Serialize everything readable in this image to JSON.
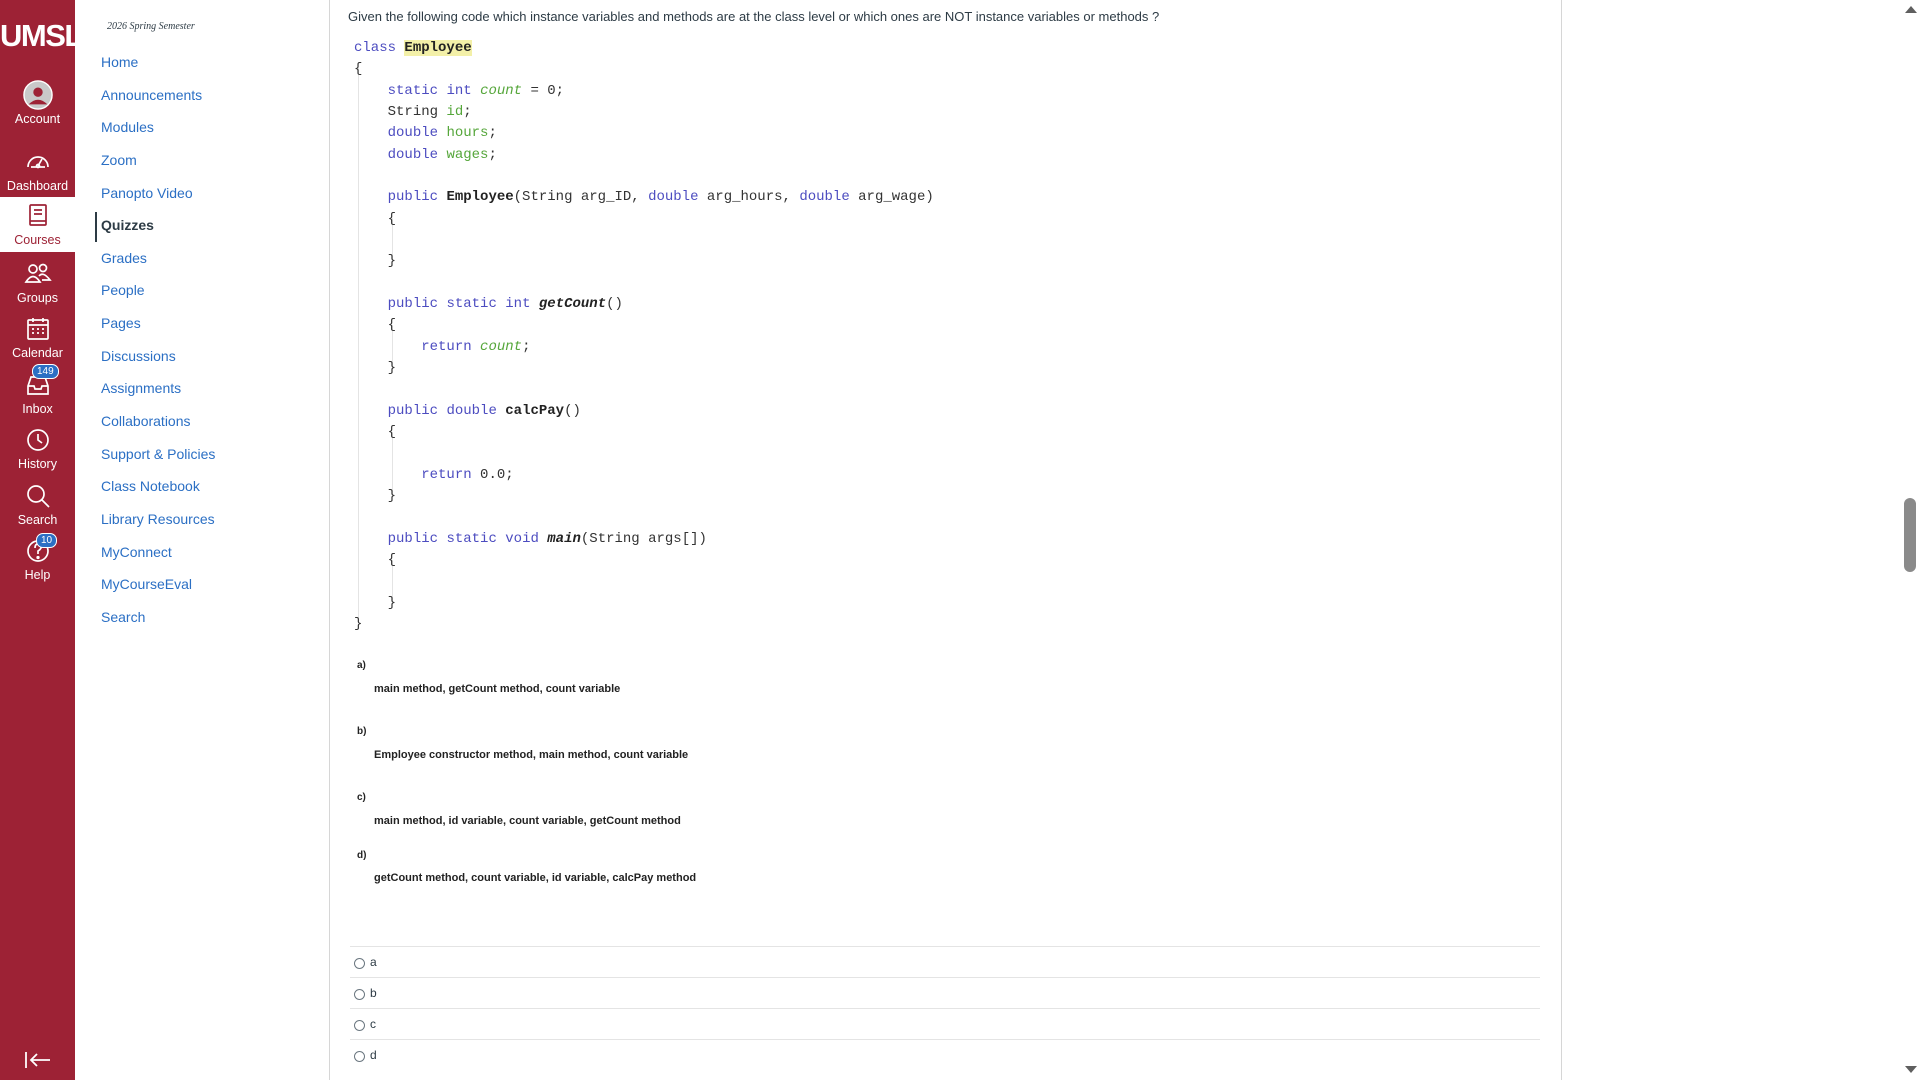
{
  "global_nav": {
    "logo": "UMSL",
    "items": [
      {
        "label": "Account",
        "icon": "account-icon"
      },
      {
        "label": "Dashboard",
        "icon": "dashboard-icon"
      },
      {
        "label": "Courses",
        "icon": "courses-icon",
        "active": true
      },
      {
        "label": "Groups",
        "icon": "groups-icon"
      },
      {
        "label": "Calendar",
        "icon": "calendar-icon"
      },
      {
        "label": "Inbox",
        "icon": "inbox-icon",
        "badge": "149"
      },
      {
        "label": "History",
        "icon": "history-icon"
      },
      {
        "label": "Search",
        "icon": "search-icon"
      },
      {
        "label": "Help",
        "icon": "help-icon",
        "badge": "10"
      }
    ],
    "collapse_icon": "collapse-nav-icon",
    "brand_color": "#9d2235"
  },
  "course_nav": {
    "term": "2026 Spring Semester",
    "items": [
      {
        "label": "Home"
      },
      {
        "label": "Announcements"
      },
      {
        "label": "Modules"
      },
      {
        "label": "Zoom"
      },
      {
        "label": "Panopto Video"
      },
      {
        "label": "Quizzes",
        "active": true
      },
      {
        "label": "Grades"
      },
      {
        "label": "People"
      },
      {
        "label": "Pages"
      },
      {
        "label": "Discussions"
      },
      {
        "label": "Assignments"
      },
      {
        "label": "Collaborations"
      },
      {
        "label": "Support & Policies"
      },
      {
        "label": "Class Notebook"
      },
      {
        "label": "Library Resources"
      },
      {
        "label": "MyConnect"
      },
      {
        "label": "MyCourseEval"
      },
      {
        "label": "Search"
      }
    ],
    "link_color": "#2b6fc4"
  },
  "question": {
    "text": "Given the following code which instance variables and methods are at the class level or which ones are NOT instance variables or methods ?",
    "code": {
      "class_kw": "class",
      "class_name": "Employee",
      "open_brace": "{",
      "close_brace": "}",
      "line_count": "static int count = 0;",
      "line_id": "String id;",
      "line_hours": "double hours;",
      "line_wages": "double wages;",
      "constructor_sig": "public Employee(String arg_ID, double arg_hours, double arg_wage)",
      "getcount_sig": "public static int getCount()",
      "getcount_body": "return count;",
      "calcpay_sig": "public double calcPay()",
      "calcpay_body": "return 0.0;",
      "main_sig": "public static void main(String args[])"
    },
    "options": [
      {
        "letter": "a)",
        "text": "main method, getCount method, count variable"
      },
      {
        "letter": "b)",
        "text": "Employee constructor method, main method, count variable"
      },
      {
        "letter": "c)",
        "text": "main method, id variable, count variable, getCount method"
      },
      {
        "letter": "d)",
        "text": "getCount method, count variable, id variable, calcPay method"
      }
    ],
    "answers": [
      "a",
      "b",
      "c",
      "d"
    ]
  }
}
